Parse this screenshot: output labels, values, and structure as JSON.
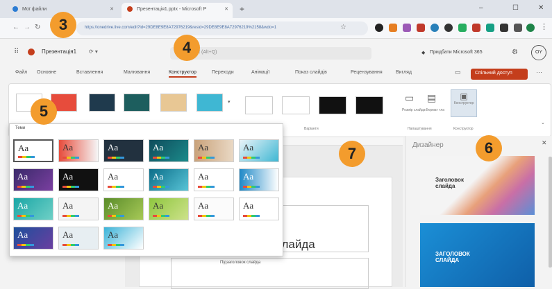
{
  "browser": {
    "tabs": [
      {
        "label": "Мої файли",
        "active": false
      },
      {
        "label": "Презентація1.pptx - Microsoft P",
        "active": true
      }
    ],
    "new_tab": "+",
    "url": "https://onedrive.live.com/edit?id=29DE8E9E8A72976219&resid=29DE8E9E8A72976219%2158&wdo=1"
  },
  "app": {
    "file_name": "Презентація1",
    "search_placeholder": "Пошук (Alt+Q)",
    "account": "Придбати Microsoft 365",
    "avatar": "OY"
  },
  "menu": {
    "items": [
      "Файл",
      "Основне",
      "Вставлення",
      "Малювання",
      "Конструктор",
      "Переходи",
      "Анімації",
      "Показ слайдів",
      "Рецензування",
      "Вигляд"
    ],
    "selected_index": 4,
    "share": "Спільний доступ"
  },
  "ribbon": {
    "variants_label": "Варіанти",
    "slide_size_label": "Розмір слайда",
    "format_bg_label": "Формат тла",
    "customize_label": "Налаштування",
    "designer_label": "Конструктор",
    "designer_group": "Конструктор"
  },
  "themes_panel": {
    "title": "Теми",
    "theme_text": "Aa"
  },
  "slide": {
    "title_fragment": "слайда",
    "subtitle": "Підзаголовок слайда"
  },
  "designer_pane": {
    "title": "Дизайнер",
    "card1_title": "Заголовок слайда",
    "card2_title": "ЗАГОЛОВОК СЛАЙДА"
  },
  "badges": [
    "3",
    "4",
    "5",
    "6",
    "7"
  ],
  "colors": {
    "accent": "#c43e1c",
    "badge": "#f39c2d"
  }
}
